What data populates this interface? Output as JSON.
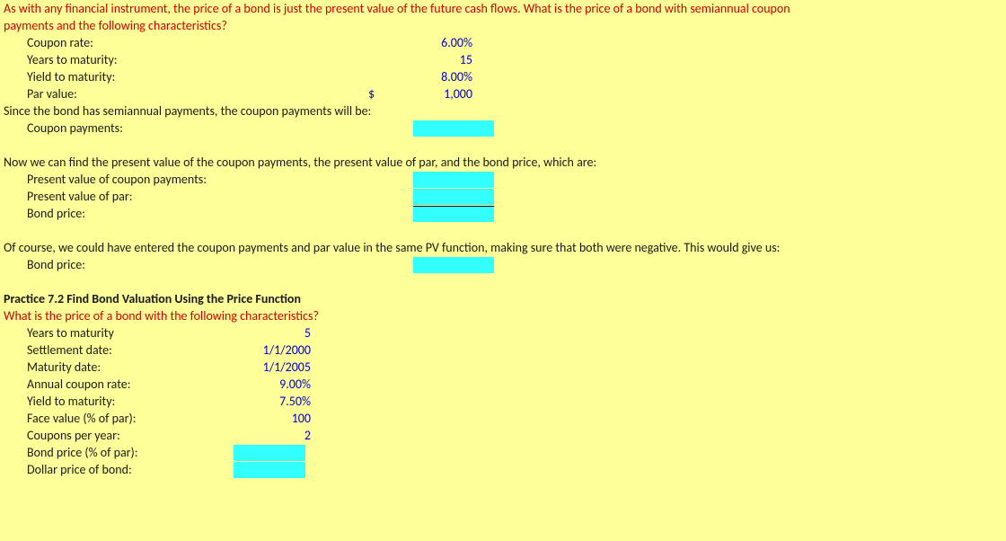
{
  "intro1": "As with any financial instrument, the price of a bond is just the present value of the future cash flows. What is the price of a bond with semiannual coupon",
  "intro2": "payments and the following characteristics?",
  "s1": {
    "coupon_rate_label": "Coupon rate:",
    "coupon_rate_value": "6.00%",
    "years_label": "Years to maturity:",
    "years_value": "15",
    "ytm_label": "Yield to maturity:",
    "ytm_value": "8.00%",
    "par_label": "Par value:",
    "par_currency": "$",
    "par_value": "1,000",
    "since_text": "Since the bond has semiannual payments, the coupon payments will be:",
    "coupon_pay_label": "Coupon payments:",
    "now_text": "Now we can find the present value of the coupon payments, the present value of par, and the bond price, which are:",
    "pv_coupon_label": "Present value of coupon payments:",
    "pv_par_label": "Present value of par:",
    "bond_price_label": "Bond price:",
    "of_course_text": "Of course, we could have entered the coupon payments and par value in the same PV function, making sure that both were negative. This would give us:",
    "bond_price2_label": "Bond price:"
  },
  "s2": {
    "heading": "Practice 7.2 Find Bond Valuation Using the Price Function",
    "question": "What is the price of a bond with the following characteristics?",
    "years_label": "Years to maturity",
    "years_value": "5",
    "settle_label": "Settlement date:",
    "settle_value": "1/1/2000",
    "maturity_label": "Maturity date:",
    "maturity_value": "1/1/2005",
    "coupon_label": "Annual coupon rate:",
    "coupon_value": "9.00%",
    "ytm_label": "Yield to maturity:",
    "ytm_value": "7.50%",
    "face_label": "Face value (% of par):",
    "face_value": "100",
    "cpy_label": "Coupons per year:",
    "cpy_value": "2",
    "bp_pct_label": "Bond price (% of par):",
    "dollar_label": "Dollar price of bond:"
  }
}
